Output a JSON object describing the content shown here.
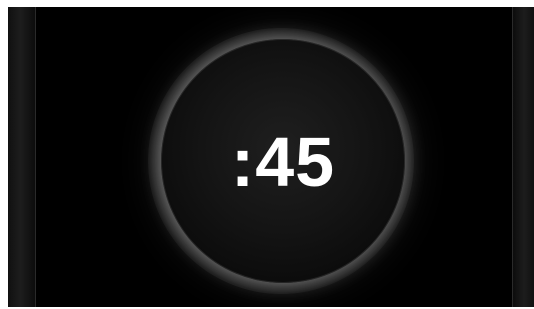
{
  "timer": {
    "display": ":45"
  },
  "colors": {
    "background": "#000000",
    "text": "#ffffff",
    "glow": "#ffffff"
  }
}
